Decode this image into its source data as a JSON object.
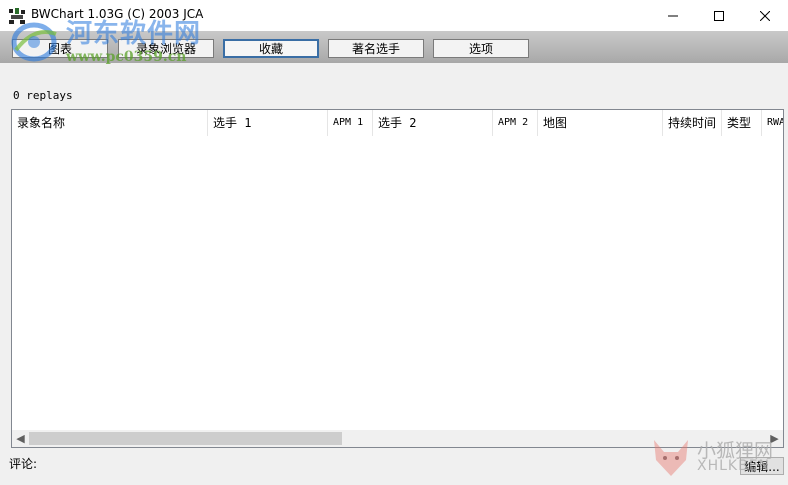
{
  "window": {
    "title": "BWChart 1.03G (C) 2003 JCA"
  },
  "toolbar": {
    "buttons": [
      {
        "label": "图表"
      },
      {
        "label": "录象浏览器"
      },
      {
        "label": "收藏"
      },
      {
        "label": "著名选手"
      },
      {
        "label": "选项"
      }
    ],
    "active_index": 2
  },
  "watermark": {
    "site_name": "河东软件网",
    "site_url": "www.pc0359.cn"
  },
  "status": {
    "replay_count": "0 replays"
  },
  "table": {
    "columns": [
      {
        "label": "录象名称"
      },
      {
        "label": "选手 1"
      },
      {
        "label": "APM 1"
      },
      {
        "label": "选手 2"
      },
      {
        "label": "APM 2"
      },
      {
        "label": "地图"
      },
      {
        "label": "持续时间"
      },
      {
        "label": "类型"
      },
      {
        "label": "RWA"
      }
    ],
    "rows": []
  },
  "footer": {
    "comment_label": "评论:",
    "edit_label": "编辑..."
  },
  "corner_watermark": {
    "name": "小狐狸网",
    "brand": "XHLKBEN"
  },
  "colors": {
    "toolbar": "#b8b8b8",
    "active_border": "#3a6ea5",
    "watermark_blue": "#2878dc",
    "watermark_green": "#5aa028"
  }
}
